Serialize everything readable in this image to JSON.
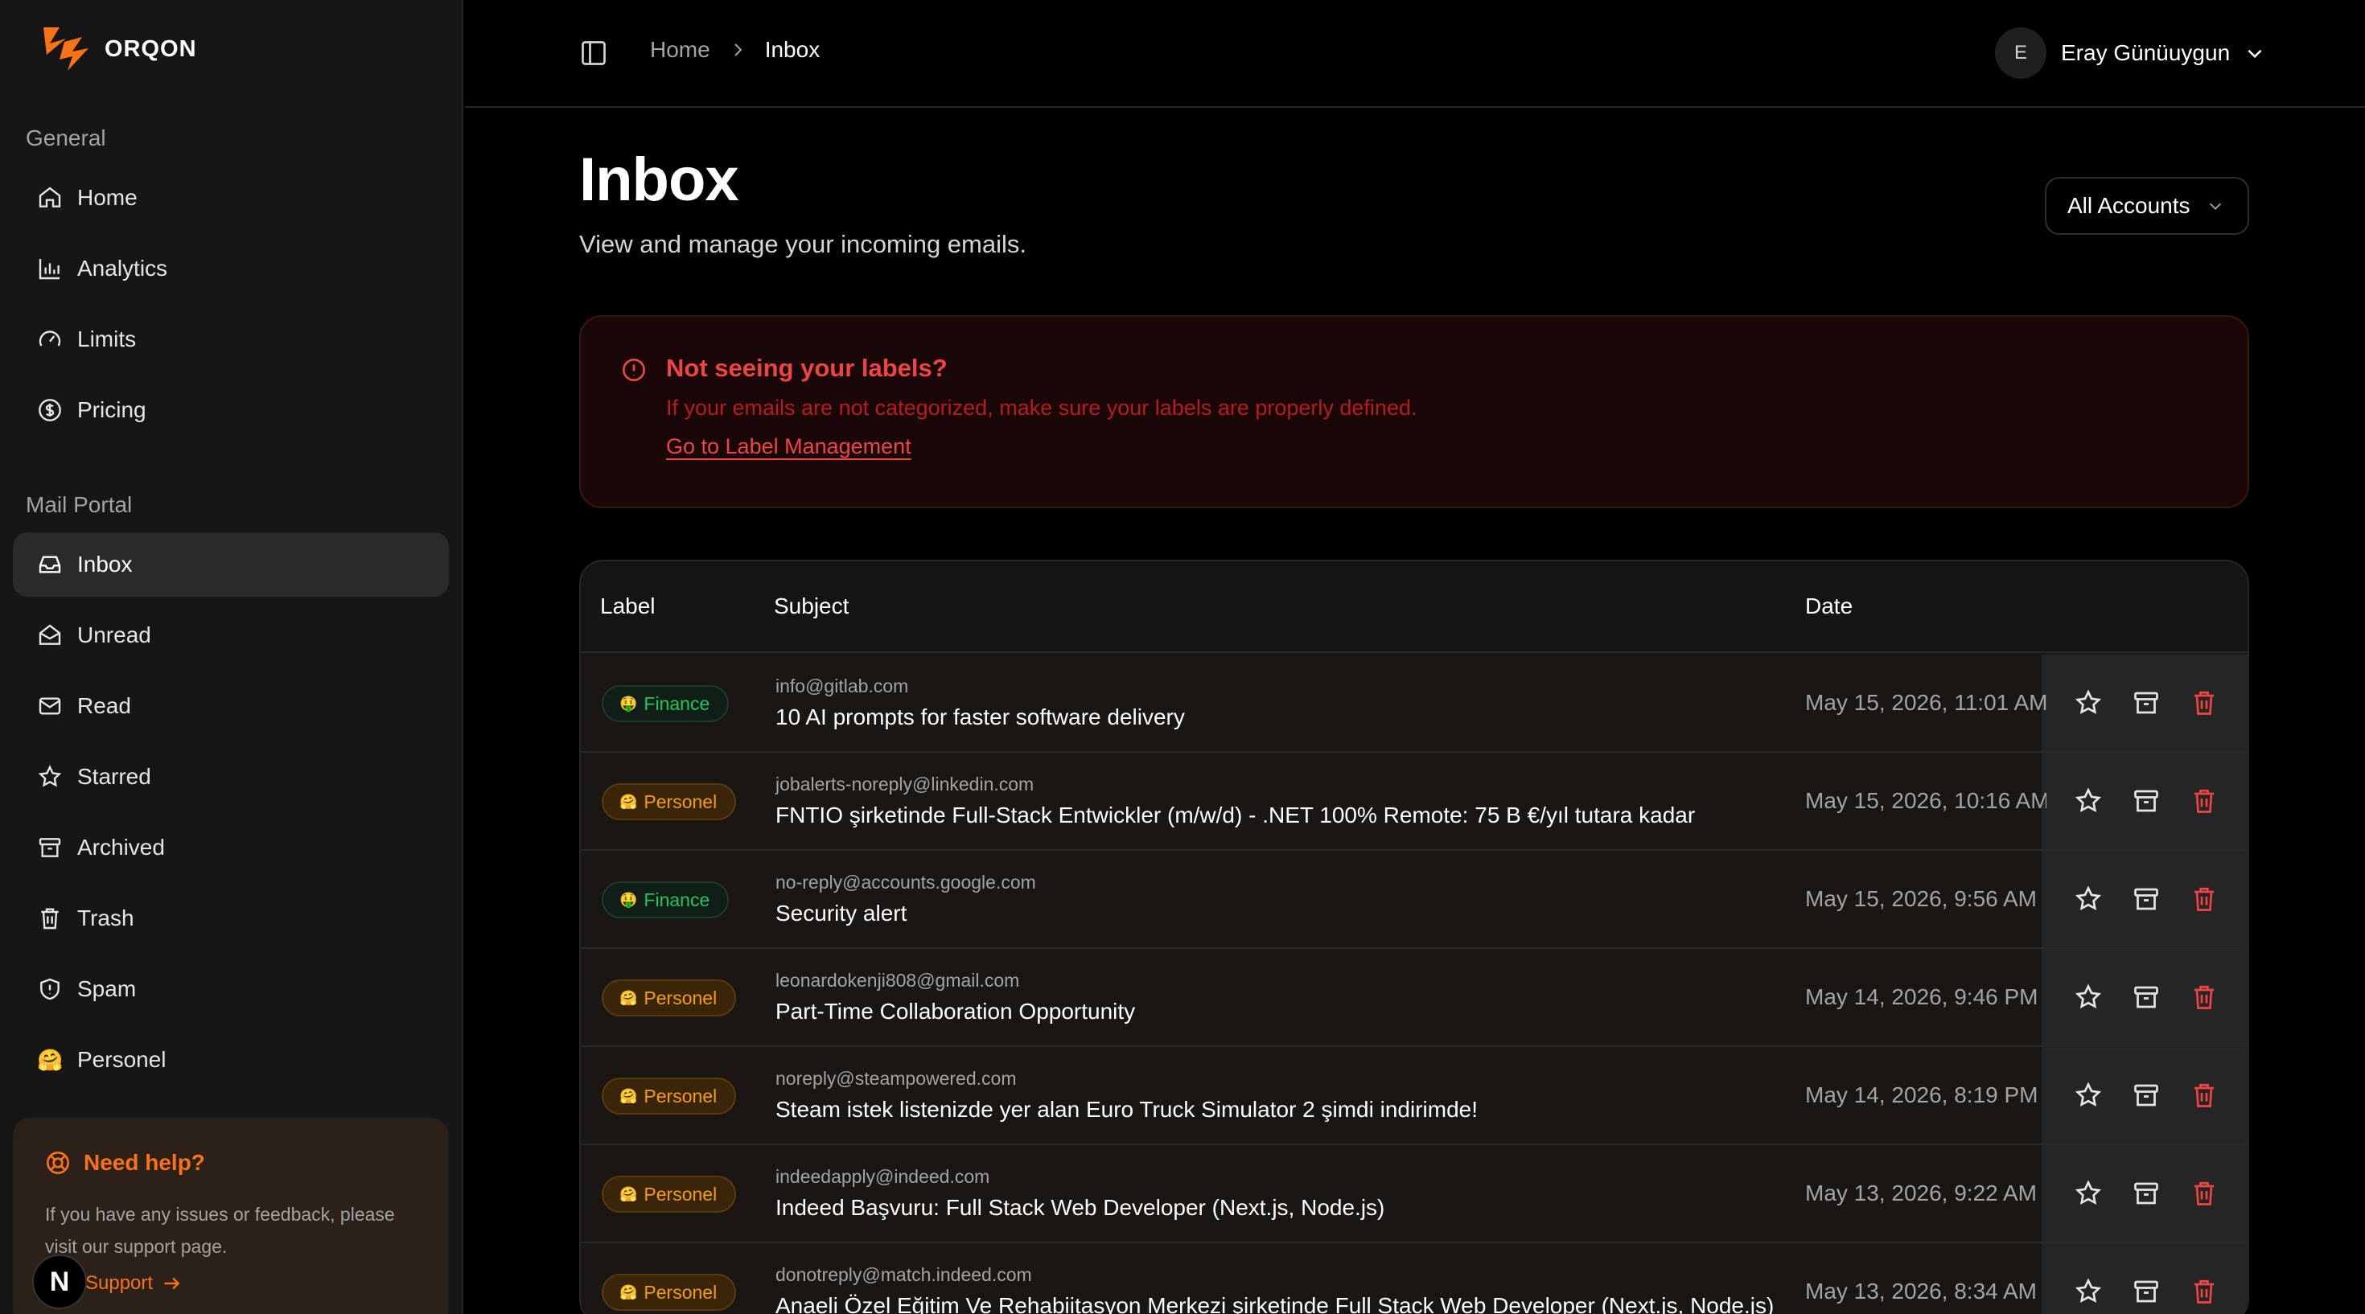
{
  "brand": {
    "name": "ORQON",
    "accent": "#f97316"
  },
  "sidebar": {
    "sections": [
      {
        "title": "General",
        "items": [
          {
            "label": "Home",
            "icon": "home-icon"
          },
          {
            "label": "Analytics",
            "icon": "bar-chart-icon"
          },
          {
            "label": "Limits",
            "icon": "gauge-icon"
          },
          {
            "label": "Pricing",
            "icon": "dollar-circle-icon"
          }
        ]
      },
      {
        "title": "Mail Portal",
        "items": [
          {
            "label": "Inbox",
            "icon": "inbox-icon",
            "active": true
          },
          {
            "label": "Unread",
            "icon": "mail-open-icon"
          },
          {
            "label": "Read",
            "icon": "mail-icon"
          },
          {
            "label": "Starred",
            "icon": "star-icon"
          },
          {
            "label": "Archived",
            "icon": "archive-icon"
          },
          {
            "label": "Trash",
            "icon": "trash-icon"
          },
          {
            "label": "Spam",
            "icon": "shield-icon"
          },
          {
            "label": "Personel",
            "icon": "emoji-icon",
            "emoji": "🤗"
          }
        ]
      }
    ],
    "help": {
      "title": "Need help?",
      "text": "If you have any issues or feedback, please visit our support page.",
      "link": "Support"
    }
  },
  "topbar": {
    "breadcrumb": {
      "home": "Home",
      "current": "Inbox"
    },
    "user": {
      "initial": "E",
      "name": "Eray Günüuygun"
    }
  },
  "header": {
    "title": "Inbox",
    "subtitle": "View and manage your incoming emails.",
    "account_filter": "All Accounts"
  },
  "alert": {
    "title": "Not seeing your labels?",
    "text": "If your emails are not categorized, make sure your labels are properly defined.",
    "link": "Go to Label Management",
    "color": "#ef4444"
  },
  "table": {
    "columns": [
      "Label",
      "Subject",
      "Date"
    ],
    "rows": [
      {
        "label": "Finance",
        "label_emoji": "🤑",
        "sender": "info@gitlab.com",
        "subject": "10 AI prompts for faster software delivery",
        "date": "May 15, 2026, 11:01 AM"
      },
      {
        "label": "Personel",
        "label_emoji": "🤗",
        "sender": "jobalerts-noreply@linkedin.com",
        "subject": "FNTIO şirketinde Full-Stack Entwickler (m/w/d) - .NET 100% Remote: 75 B €/yıl tutara kadar",
        "date": "May 15, 2026, 10:16 AM"
      },
      {
        "label": "Finance",
        "label_emoji": "🤑",
        "sender": "no-reply@accounts.google.com",
        "subject": "Security alert",
        "date": "May 15, 2026, 9:56 AM"
      },
      {
        "label": "Personel",
        "label_emoji": "🤗",
        "sender": "leonardokenji808@gmail.com",
        "subject": "Part-Time Collaboration Opportunity",
        "date": "May 14, 2026, 9:46 PM"
      },
      {
        "label": "Personel",
        "label_emoji": "🤗",
        "sender": "noreply@steampowered.com",
        "subject": "Steam istek listenizde yer alan Euro Truck Simulator 2 şimdi indirimde!",
        "date": "May 14, 2026, 8:19 PM"
      },
      {
        "label": "Personel",
        "label_emoji": "🤗",
        "sender": "indeedapply@indeed.com",
        "subject": "Indeed Başvuru: Full Stack Web Developer (Next.js, Node.js)",
        "date": "May 13, 2026, 9:22 AM"
      },
      {
        "label": "Personel",
        "label_emoji": "🤗",
        "sender": "donotreply@match.indeed.com",
        "subject": "Anaeli Özel Eğitim Ve Rehabiitasyon Merkezi şirketinde Full Stack Web Developer (Next.js, Node.js)",
        "date": "May 13, 2026, 8:34 AM"
      }
    ]
  }
}
